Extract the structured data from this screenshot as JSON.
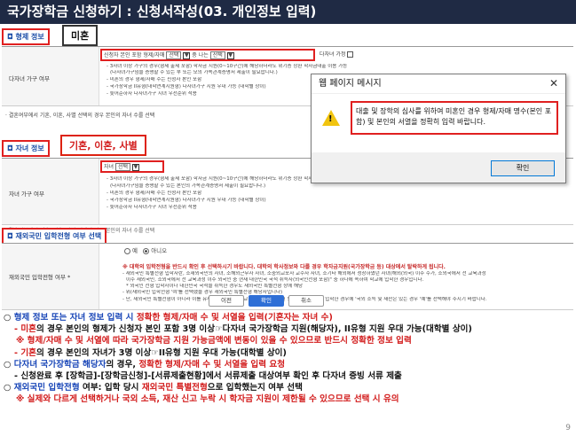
{
  "title": "국가장학금 신청하기 : 신청서작성(03. 개인정보 입력)",
  "sections": {
    "sibling": {
      "label": "형제 정보",
      "callout": "미혼",
      "row_label": "다자녀 가구 여부",
      "select_prefix": "신청자 본인 포함 형제/자매",
      "select_a": "선택",
      "or_text": "중 나는",
      "select_b": "선택",
      "multi_label": "다자녀 가정",
      "notes": [
        "- 3자녀 이상 가구의 경우(형제 출제 포함) 학자금 지원(0~10구간)에 해당하더라도 위기증 상환 학자금대출 이용 가능",
        "(다자녀가구임을 증명할 수 있는 부 또는 모의 가족관계증명서 제출이 필요합니다.)",
        "- 미혼의 경우 형제/자매 수는 신청자 본인 포함",
        "- 국가장학금 II유형(대학연계지원형) 다자녀가구 지원 우대 가능 (대학별 상이)",
        "- 늦어준하자 다자녀가구 지녀 우선순위 적용"
      ],
      "footnote": "· 결혼여부에서 기혼, 이혼, 사별 선택의 경우 본인의 자녀 수를 선택"
    },
    "children": {
      "label": "자녀 정보",
      "callout": "기혼, 이혼, 사별",
      "row_label": "자녀 가구 여부",
      "select_prefix": "자녀",
      "select_a": "선택",
      "notes": [
        "- 3자녀 이상 가구의 경우(형제 출제 포함) 학자금 지원(0~10구간)에 해당하더라도 위기증 상환 학자금대출 이용 가능",
        "(다자녀가구임을 증명할 수 있는 본인의 가족관계증명서 제출이 필요합니다.)",
        "- 미혼의 경우 형제/자매 수는 신청자 본인 포함",
        "- 국가장학금 II유형(대학연계지원형) 다자녀가구 지원 우대 가능 (대학별 상이)",
        "- 늦어준하자 다자녀가구 지녀 우선순위 적용"
      ],
      "footnote": "· 결혼여부에서 기혼, 이혼, 사별 선택의 경우 본인의 자녀 수를 선택"
    },
    "overseas": {
      "label": "재외국민 입학전형 여부 선택",
      "row_label": "재외국민 입학전형 여부 *",
      "option_yes": "예",
      "option_no": "아니오",
      "warning": "※ 대학의 입학전형을 반드시 확인 후 선택하시기 바랍니다. 대학의 학사정보와 다를 경우 학자금지원(국가장학금 등) 대상에서 탈락하게 됩니다.",
      "notes": [
        "- 재외국민 특별전형 입학자란, 소재외국민의 자녀, 소해외근무자 자녀, 소중외교포자 교수자 자녀, 소기타 해외에서 성장하였던 자녀(해외(외국) 이주 수가, 소외국에서 전 교육과정",
        "이수 재외국민, 소외국에서 전 교육과정 이수 외국인 중 현재 대한민국 국적 취득자(외국인전형 포함)\" 중 하나에 속하여 학교에 입학한 경우입니다.",
        "* 외국인 전형 입학자이나 대한민국 국적을 취득한 경우도 재외국민 특별전형 상에 해당",
        "- 위(재외국민 입학전형 '여'를 선택했을 경우 재외국민 특별전형 해당자입니다)",
        "- 단, 재외국민 특별전형이 아니라 이를 유사한 전형(국내 학교 졸업 학생 및 정원 외 교육자 등)으로 입학한 경우에 '국외 소득 및 재산은 있는 경우 '예'를 선택해야 주시기 바랍니다."
      ]
    }
  },
  "dialog": {
    "title": "웹 페이지 메시지",
    "message": "대출 및 장학의 심사를 위하여 미혼인 경우 형제/자매 명수(본인 포함) 및 본인의 서열을 정확히 입력 바랍니다.",
    "ok_label": "확인"
  },
  "buttons": {
    "prev": "이전",
    "confirm": "확인",
    "cancel": "취소"
  },
  "bullets": {
    "l1_mark": "○",
    "l1_a": "형제 정보 또는 자녀 정보 입력 시",
    "l1_b": "정확한 형제/자매 수 및 서열을 입력(기혼자는 자녀 수)",
    "l2_a": "- 미혼",
    "l2_b": "의 경우 본인의 형제가 신청자 본인 포함 3명 이상☞다자녀 국가장학금 지원(해당자), II유형 지원 우대 가능(대학별 상이)",
    "l3": "※ 형제/자매 수 및 서열에 따라 국가장학금 지원 가능금액에 변동이 있을 수 있으므로 반드시 정확한 정보 입력",
    "l4_a": "- 기혼",
    "l4_b": "의 경우 본인의 자녀가 3명 이상☞II유형 지원 우대 가능(대학별 상이)",
    "l5_mark": "○",
    "l5_a": "다자녀 국가장학금 해당자",
    "l5_b": "의 경우,",
    "l5_c": "정확한 형제/자매 수 및 서열을 입력 요청",
    "l6": "- 신청완료 후 [장학금]-[장학금신청]-[서류제출현황]에서 서류제출 대상여부 확인 후 다자녀 증빙 서류 제출",
    "l7_mark": "○",
    "l7_a": "재외국민 입학전형",
    "l7_b": "여부: 입학 당시",
    "l7_c": "재외국민 특별전형",
    "l7_d": "으로 입학했는지 여부 선택",
    "l8": "※ 실제와 다르게 선택하거나 국외 소득, 재산 신고 누락 시 학자금 지원이 제한될 수 있으므로 선택 시 유의"
  },
  "page_number": "9"
}
